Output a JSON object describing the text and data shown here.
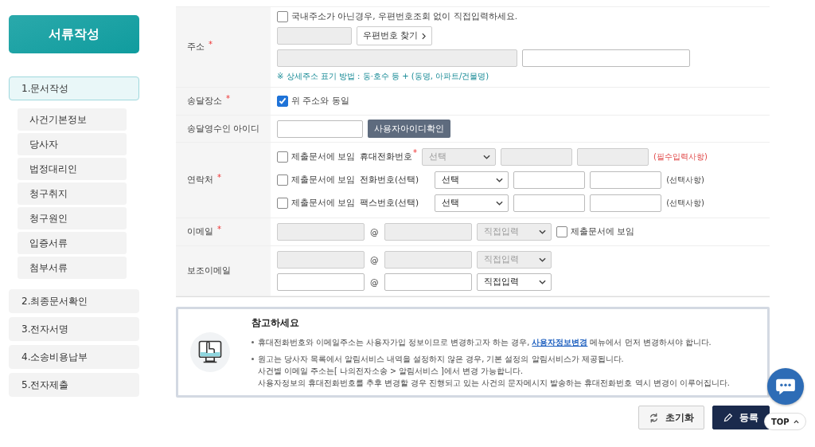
{
  "sidebar": {
    "header": "서류작성",
    "steps": [
      {
        "label": "1.문서작성",
        "selected": true,
        "children": [
          {
            "label": "사건기본정보"
          },
          {
            "label": "당사자"
          },
          {
            "label": "법정대리인"
          },
          {
            "label": "청구취지"
          },
          {
            "label": "청구원인"
          },
          {
            "label": "입증서류"
          },
          {
            "label": "첨부서류"
          }
        ]
      },
      {
        "label": "2.최종문서확인",
        "selected": false
      },
      {
        "label": "3.전자서명",
        "selected": false
      },
      {
        "label": "4.소송비용납부",
        "selected": false
      },
      {
        "label": "5.전자제출",
        "selected": false
      }
    ]
  },
  "form": {
    "rows": [
      {
        "kind": "address",
        "label": "주소",
        "required_mark": "*",
        "checkbox": {
          "label": "국내주소가 아닌경우, 우편번호조회 없이 직접입력하세요.",
          "checked": false
        },
        "zip_button": "우편번호 찾기",
        "note": "※ 상세주소 표기 방법 : 동·호수 등 + (동명, 아파트/건물명)"
      },
      {
        "kind": "check",
        "label": "송달장소",
        "required_mark": "*",
        "checkbox": {
          "label": "위 주소와 동일",
          "checked": true
        }
      },
      {
        "kind": "id",
        "label": "송달영수인 아이디",
        "button": "사용자아이디확인"
      },
      {
        "kind": "phones",
        "label": "연락처",
        "required_mark": "*",
        "lines": [
          {
            "show_label": "제출문서에 보임",
            "checked": false,
            "field_label": "휴대전화번호",
            "required_mark": "*",
            "select": "선택",
            "disabled": true,
            "note": "(필수입력사항)",
            "emphasis": true
          },
          {
            "show_label": "제출문서에 보임",
            "checked": false,
            "field_label": "전화번호(선택)",
            "select": "선택",
            "disabled": false,
            "note": "(선택사항)",
            "emphasis": false
          },
          {
            "show_label": "제출문서에 보임",
            "checked": false,
            "field_label": "팩스번호(선택)",
            "select": "선택",
            "disabled": false,
            "note": "(선택사항)",
            "emphasis": false
          }
        ]
      },
      {
        "kind": "email",
        "label": "이메일",
        "required_mark": "*",
        "lines": [
          {
            "at": "@",
            "select": "직접입력",
            "disabled": true,
            "checkbox": {
              "label": "제출문서에 보임",
              "checked": false
            }
          }
        ]
      },
      {
        "kind": "email",
        "label": "보조이메일",
        "lines": [
          {
            "at": "@",
            "select": "직접입력",
            "disabled": true
          },
          {
            "at": "@",
            "select": "직접입력",
            "disabled": false
          }
        ]
      }
    ]
  },
  "notice": {
    "title": "참고하세요",
    "items": [
      {
        "before": "휴대전화번호와 이메일주소는 사용자가입 정보이므로 변경하고자 하는 경우,",
        "link": "사용자정보변경",
        "after": "메뉴에서 먼저 변경하셔야 합니다."
      },
      {
        "lines": [
          "원고는 당사자 목록에서 알림서비스 내역을 설정하지 않은 경우, 기본 설정의 알림서비스가 제공됩니다.",
          "사건별 이메일 주소는[ 나의전자소송 > 알림서비스 ]에서 변경 가능합니다.",
          "사용자정보의 휴대전화번호를 추후 변경할 경우 진행되고 있는 사건의 문자메시지 발송하는 휴대전화번호 역시 변경이 이루어집니다."
        ]
      }
    ]
  },
  "buttons": [
    {
      "kind": "reset",
      "label": "초기화"
    },
    {
      "kind": "submit",
      "label": "등록"
    }
  ],
  "top_button": "TOP"
}
